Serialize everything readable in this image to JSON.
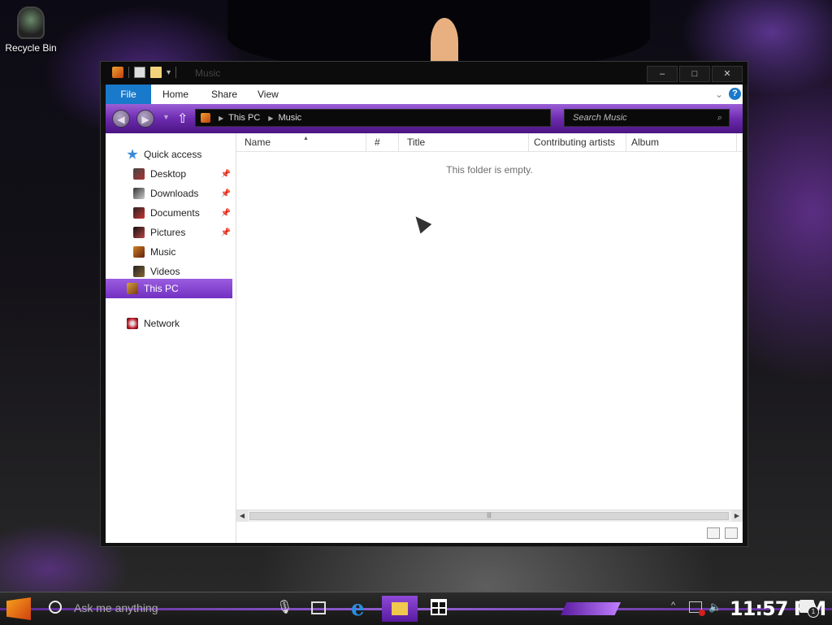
{
  "desktop": {
    "recycle_bin_label": "Recycle Bin"
  },
  "window": {
    "title": "Music",
    "controls": {
      "minimize": "–",
      "maximize": "□",
      "close": "✕"
    },
    "ribbon": {
      "tabs": [
        "File",
        "Home",
        "Share",
        "View"
      ],
      "help": "?"
    },
    "address": {
      "path": [
        "This PC",
        "Music"
      ],
      "search_placeholder": "Search Music"
    },
    "nav": {
      "quick_access": "Quick access",
      "items": [
        {
          "label": "Desktop",
          "pinned": true
        },
        {
          "label": "Downloads",
          "pinned": true
        },
        {
          "label": "Documents",
          "pinned": true
        },
        {
          "label": "Pictures",
          "pinned": true
        },
        {
          "label": "Music",
          "pinned": false
        },
        {
          "label": "Videos",
          "pinned": false
        }
      ],
      "this_pc": "This PC",
      "network": "Network"
    },
    "columns": [
      "Name",
      "#",
      "Title",
      "Contributing artists",
      "Album"
    ],
    "empty_message": "This folder is empty."
  },
  "taskbar": {
    "search_placeholder": "Ask me anything",
    "clock": "11:57 PM",
    "notification_count": "1"
  },
  "colors": {
    "accent": "#7a35c8",
    "file_tab": "#1979ca"
  }
}
